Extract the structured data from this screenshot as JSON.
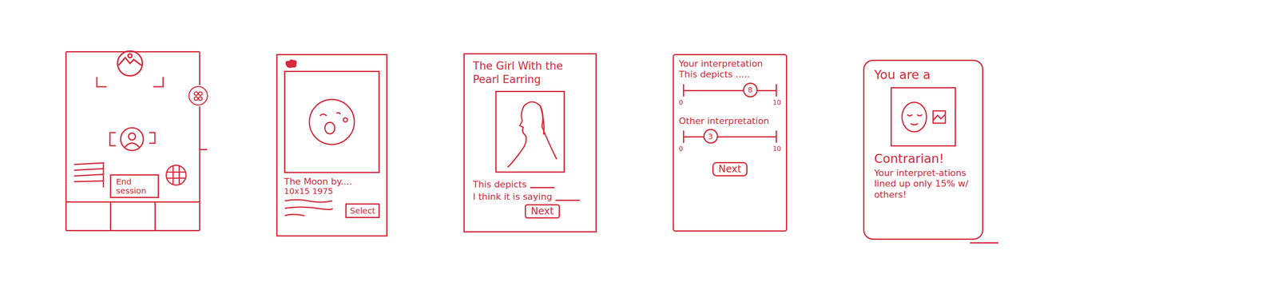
{
  "screens": [
    {
      "kind": "map",
      "button": "End session"
    },
    {
      "kind": "detail",
      "title": "The Moon by....",
      "meta": "10x15 1975",
      "button": "Select"
    },
    {
      "kind": "prompt",
      "title": "The Girl With the Pearl Earring",
      "fields": [
        {
          "label": "This depicts"
        },
        {
          "label": "I think it is saying"
        }
      ],
      "button": "Next"
    },
    {
      "kind": "compare",
      "sliders": [
        {
          "label": "Your interpretation",
          "caption": "This depicts .....",
          "min": "0",
          "max": "10",
          "value": "8",
          "level": 0.72
        },
        {
          "label": "Other interpretation",
          "caption": "",
          "min": "0",
          "max": "10",
          "value": "3",
          "level": 0.29
        }
      ],
      "button": "Next"
    },
    {
      "kind": "result",
      "heading": "You are a",
      "result": "Contrarian!",
      "message": "Your interpret-ations lined up only 15% w/ others!"
    }
  ]
}
